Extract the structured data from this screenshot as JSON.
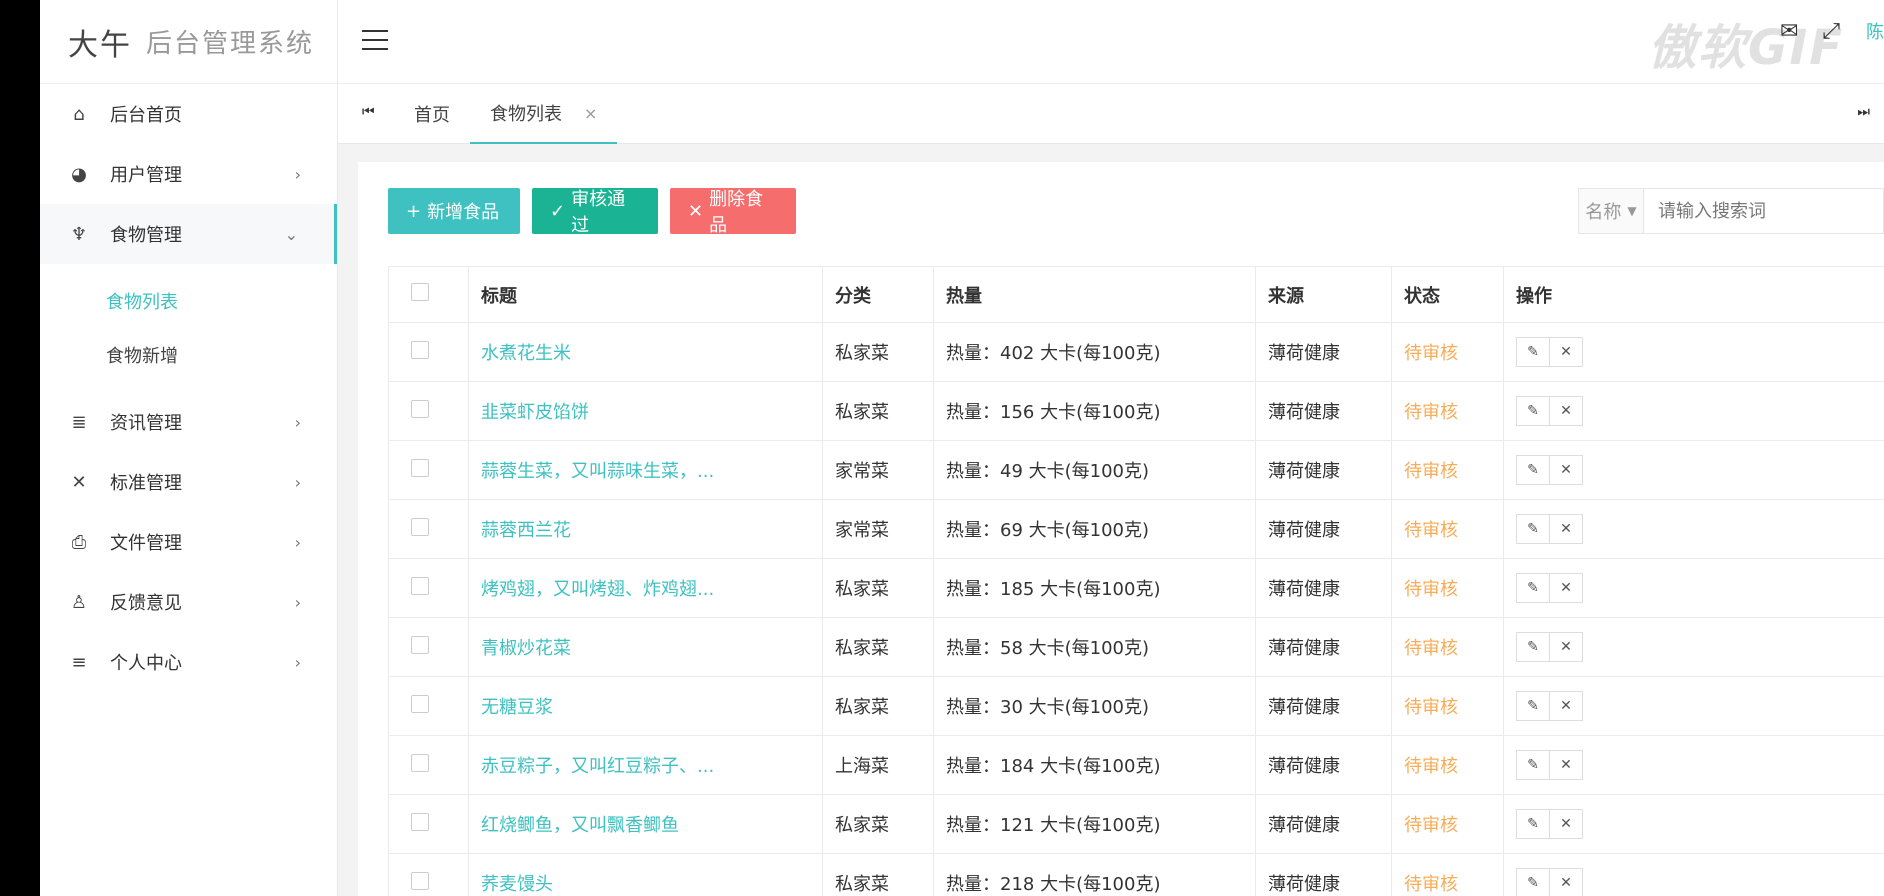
{
  "app": {
    "logo_mark": "大午",
    "logo_text": "后台管理系统"
  },
  "header": {
    "user_name": "陈",
    "watermark": "傲软GIF"
  },
  "sidebar": {
    "items": [
      {
        "label": "后台首页",
        "icon": "home-icon",
        "has_arrow": false
      },
      {
        "label": "用户管理",
        "icon": "palette-icon",
        "has_arrow": true
      },
      {
        "label": "食物管理",
        "icon": "microphone-icon",
        "has_arrow": true,
        "open": true
      },
      {
        "label": "资讯管理",
        "icon": "list-icon",
        "has_arrow": true
      },
      {
        "label": "标准管理",
        "icon": "tools-icon",
        "has_arrow": true
      },
      {
        "label": "文件管理",
        "icon": "file-icon",
        "has_arrow": true
      },
      {
        "label": "反馈意见",
        "icon": "user-feedback-icon",
        "has_arrow": true
      },
      {
        "label": "个人中心",
        "icon": "menu-icon",
        "has_arrow": true
      }
    ],
    "sub_items": [
      {
        "label": "食物列表",
        "active": true
      },
      {
        "label": "食物新增",
        "active": false
      }
    ]
  },
  "tabs": [
    {
      "label": "首页"
    },
    {
      "label": "食物列表",
      "closable": true,
      "close": "×"
    }
  ],
  "toolbar": {
    "add_icon": "+",
    "add_label": "新增食品",
    "approve_icon": "✓",
    "approve_label": "审核通过",
    "delete_icon": "✕",
    "delete_label": "删除食品"
  },
  "search": {
    "field": "名称",
    "placeholder": "请输入搜索词"
  },
  "table": {
    "columns": [
      "标题",
      "分类",
      "热量",
      "来源",
      "状态",
      "操作"
    ],
    "rows": [
      {
        "title": "水煮花生米",
        "category": "私家菜",
        "calories": "热量：402 大卡(每100克)",
        "source": "薄荷健康",
        "status": "待审核"
      },
      {
        "title": "韭菜虾皮馅饼",
        "category": "私家菜",
        "calories": "热量：156 大卡(每100克)",
        "source": "薄荷健康",
        "status": "待审核"
      },
      {
        "title": "蒜蓉生菜，又叫蒜味生菜，...",
        "category": "家常菜",
        "calories": "热量：49 大卡(每100克)",
        "source": "薄荷健康",
        "status": "待审核"
      },
      {
        "title": "蒜蓉西兰花",
        "category": "家常菜",
        "calories": "热量：69 大卡(每100克)",
        "source": "薄荷健康",
        "status": "待审核"
      },
      {
        "title": "烤鸡翅，又叫烤翅、炸鸡翅...",
        "category": "私家菜",
        "calories": "热量：185 大卡(每100克)",
        "source": "薄荷健康",
        "status": "待审核"
      },
      {
        "title": "青椒炒花菜",
        "category": "私家菜",
        "calories": "热量：58 大卡(每100克)",
        "source": "薄荷健康",
        "status": "待审核"
      },
      {
        "title": "无糖豆浆",
        "category": "私家菜",
        "calories": "热量：30 大卡(每100克)",
        "source": "薄荷健康",
        "status": "待审核"
      },
      {
        "title": "赤豆粽子，又叫红豆粽子、...",
        "category": "上海菜",
        "calories": "热量：184 大卡(每100克)",
        "source": "薄荷健康",
        "status": "待审核"
      },
      {
        "title": "红烧鲫鱼，又叫飘香鲫鱼",
        "category": "私家菜",
        "calories": "热量：121 大卡(每100克)",
        "source": "薄荷健康",
        "status": "待审核"
      },
      {
        "title": "荞麦馒头",
        "category": "私家菜",
        "calories": "热量：218 大卡(每100克)",
        "source": "薄荷健康",
        "status": "待审核"
      }
    ]
  },
  "colors": {
    "accent": "#3fc1c1",
    "success": "#1ab394",
    "danger": "#f56d6d",
    "warning": "#f8ac59"
  }
}
